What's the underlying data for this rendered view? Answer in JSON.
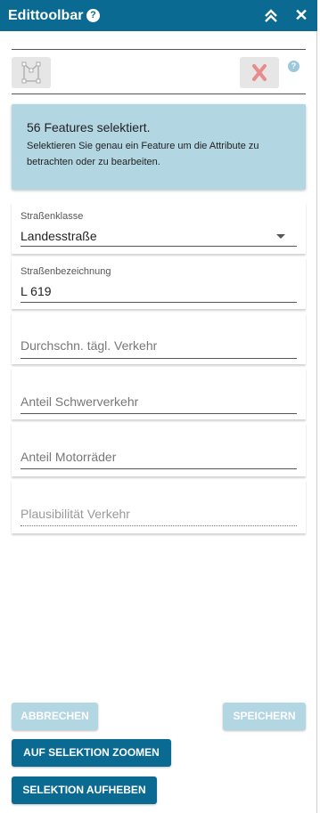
{
  "header": {
    "title": "Edittoolbar",
    "help": "?",
    "close": "✕"
  },
  "toolbar": {
    "help": "?"
  },
  "info": {
    "heading": "56 Features selektiert.",
    "text": "Selektieren Sie genau ein Feature um die Attribute zu betrachten oder zu bearbeiten."
  },
  "fields": {
    "strassenklasse": {
      "label": "Straßenklasse",
      "value": "Landesstraße"
    },
    "strassenbezeichnung": {
      "label": "Straßenbezeichnung",
      "value": "L 619"
    },
    "dtv": {
      "placeholder": "Durchschn. tägl. Verkehr"
    },
    "schwerverkehr": {
      "placeholder": "Anteil Schwerverkehr"
    },
    "motorraeder": {
      "placeholder": "Anteil Motorräder"
    },
    "plausibilitaet": {
      "placeholder": "Plausibilität Verkehr"
    }
  },
  "buttons": {
    "cancel": "ABBRECHEN",
    "save": "SPEICHERN",
    "zoom": "AUF SELEKTION ZOOMEN",
    "clear": "SELEKTION AUFHEBEN"
  },
  "colors": {
    "primary": "#0a6a92",
    "disabled": "#b2d6e2",
    "info_bg": "#b2d6e2",
    "delete_icon": "#e88b8b"
  }
}
